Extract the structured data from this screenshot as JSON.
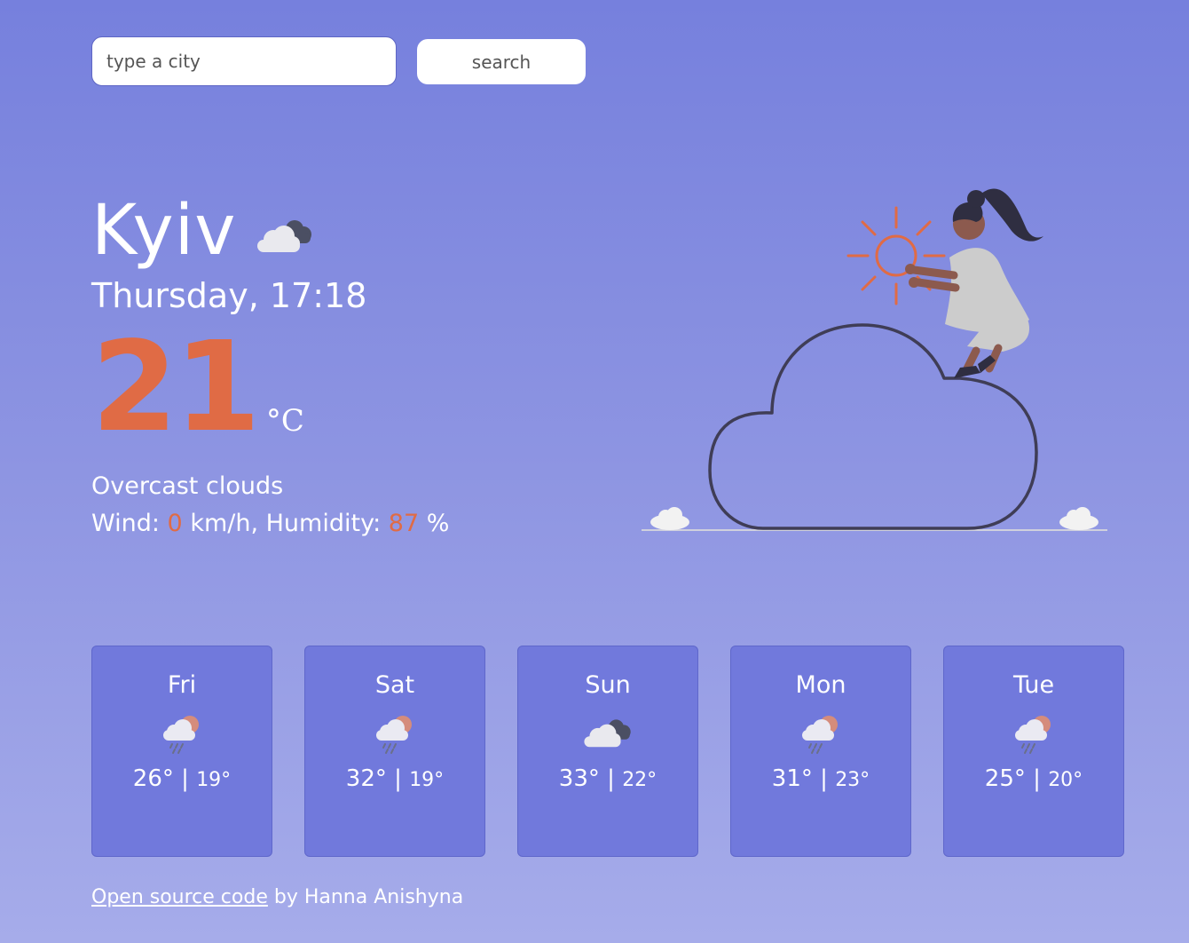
{
  "search": {
    "placeholder": "type a city",
    "button_label": "search"
  },
  "current": {
    "city": "Kyiv",
    "icon": "overcast-clouds-icon",
    "datetime": "Thursday, 17:18",
    "temperature": "21",
    "unit": "°C",
    "description": "Overcast clouds",
    "wind_label": "Wind: ",
    "wind_value": "0",
    "wind_unit": " km/h, Humidity: ",
    "humidity_value": "87",
    "humidity_unit": " %"
  },
  "forecast": [
    {
      "day": "Fri",
      "icon": "rain-icon",
      "max": "26°",
      "min": "19°"
    },
    {
      "day": "Sat",
      "icon": "rain-icon",
      "max": "32°",
      "min": "19°"
    },
    {
      "day": "Sun",
      "icon": "overcast-clouds-icon",
      "max": "33°",
      "min": "22°"
    },
    {
      "day": "Mon",
      "icon": "rain-icon",
      "max": "31°",
      "min": "23°"
    },
    {
      "day": "Tue",
      "icon": "rain-icon",
      "max": "25°",
      "min": "20°"
    }
  ],
  "footer": {
    "link_text": "Open source code",
    "author_text": " by Hanna Anishyna"
  },
  "colors": {
    "accent": "#e06b45",
    "card_background": "#7179dc",
    "background_top": "#7680dd",
    "background_bottom": "#a6acea"
  }
}
